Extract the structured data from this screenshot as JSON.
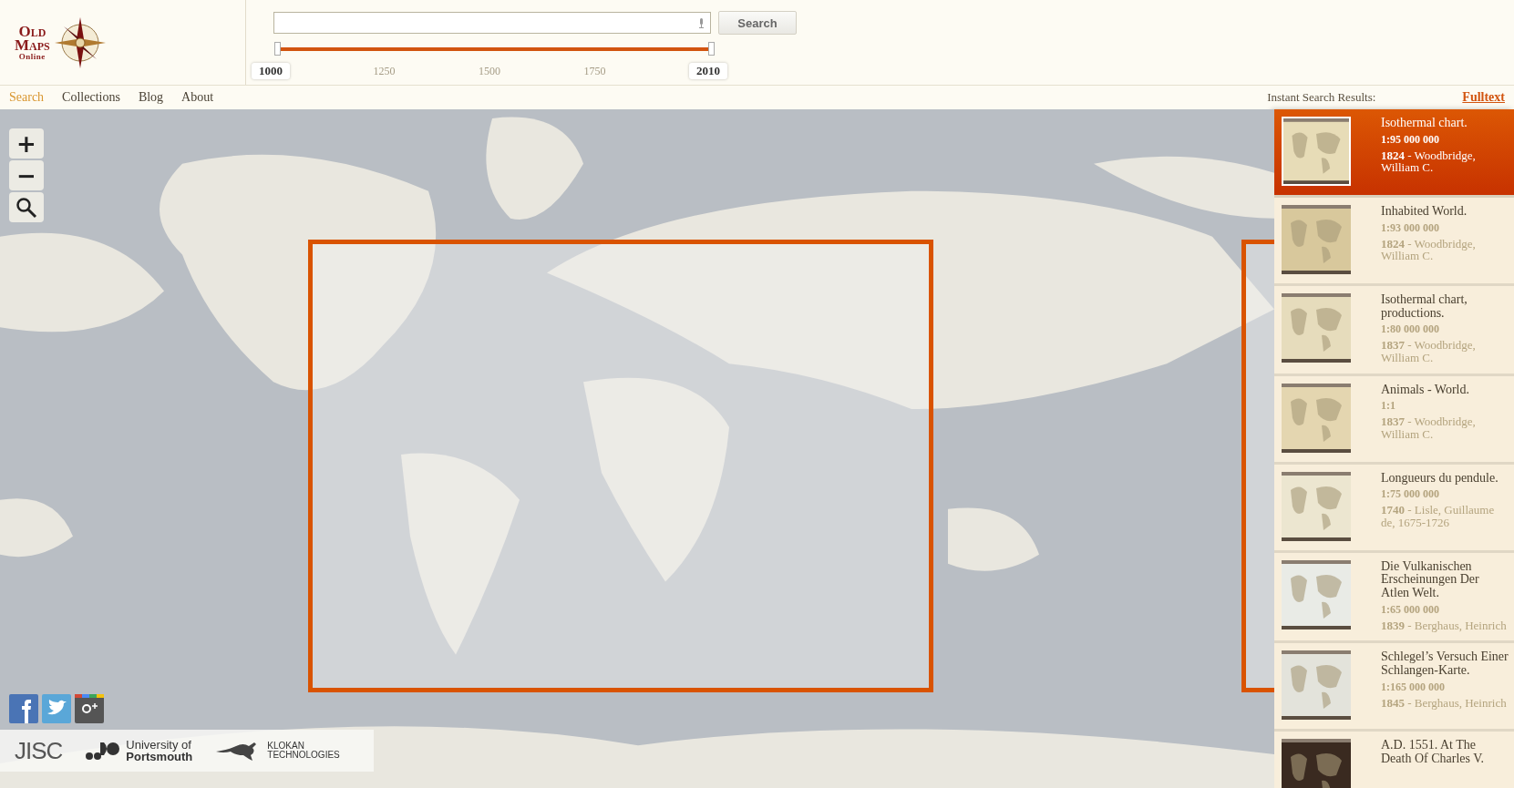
{
  "logo": {
    "line_1": "Old",
    "line_2": "Maps",
    "line_3": "Online"
  },
  "search": {
    "button": "Search"
  },
  "time_range": {
    "low": {
      "label": "1000",
      "level": 0
    },
    "high": {
      "label": "2010",
      "level": 1
    },
    "ticks": [
      "1250",
      "1500",
      "1750"
    ]
  },
  "nav": [
    {
      "label": "Search",
      "selected": true
    },
    {
      "label": "Collections",
      "selected": false
    },
    {
      "label": "Blog",
      "selected": false
    },
    {
      "label": "About",
      "selected": false
    }
  ],
  "results_header": {
    "title": "Instant Search Results:",
    "link": "Fulltext"
  },
  "map": {
    "kind": "picture",
    "zoom_in": "+",
    "zoom_out": "−"
  },
  "partners": [
    {
      "kind": "jisc",
      "name": "JISC"
    },
    {
      "kind": "portsmouth",
      "line_1": "University of",
      "line_2": "Portsmouth"
    },
    {
      "kind": "klokan",
      "line_1": "KLOKAN",
      "line_2": "TECHNOLOGIES"
    }
  ],
  "results": [
    {
      "title": "Isothermal chart.",
      "scale": "1:95 000 000",
      "year": "1824",
      "author": "- Woodbridge, William C.",
      "selected": true
    },
    {
      "title": "Inhabited World.",
      "scale": "1:93 000 000",
      "year": "1824",
      "author": "- Woodbridge, William C.",
      "selected": false
    },
    {
      "title": "Isothermal chart, productions.",
      "scale": "1:80 000 000",
      "year": "1837",
      "author": "- Woodbridge, William C.",
      "selected": false
    },
    {
      "title": "Animals - World.",
      "scale": "1:1",
      "year": "1837",
      "author": "- Woodbridge, William C.",
      "selected": false
    },
    {
      "title": "Longueurs du pendule.",
      "scale": "1:75 000 000",
      "year": "1740",
      "author": "- Lisle, Guillaume de, 1675-1726",
      "selected": false
    },
    {
      "title": "Die Vulkanischen Erscheinungen Der Atlen Welt.",
      "scale": "1:65 000 000",
      "year": "1839",
      "author": "- Berghaus, Heinrich",
      "selected": false
    },
    {
      "title": "Schlegel’s Versuch Einer Schlangen-Karte.",
      "scale": "1:165 000 000",
      "year": "1845",
      "author": "- Berghaus, Heinrich",
      "selected": false
    },
    {
      "title": "A.D. 1551. At The Death Of Charles V.",
      "selected": false
    }
  ]
}
